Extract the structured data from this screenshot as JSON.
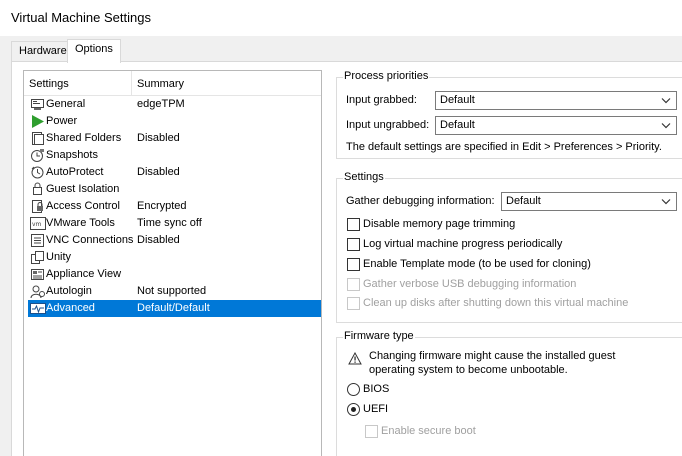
{
  "window": {
    "title": "Virtual Machine Settings"
  },
  "tabs": [
    {
      "label": "Hardware",
      "active": false
    },
    {
      "label": "Options",
      "active": true
    }
  ],
  "settings_list": {
    "columns": [
      "Settings",
      "Summary"
    ],
    "rows": [
      {
        "name": "General",
        "summary": "edgeTPM",
        "icon": "general-icon"
      },
      {
        "name": "Power",
        "summary": "",
        "icon": "power-icon"
      },
      {
        "name": "Shared Folders",
        "summary": "Disabled",
        "icon": "shared-folders-icon"
      },
      {
        "name": "Snapshots",
        "summary": "",
        "icon": "snapshots-icon"
      },
      {
        "name": "AutoProtect",
        "summary": "Disabled",
        "icon": "autoprotect-icon"
      },
      {
        "name": "Guest Isolation",
        "summary": "",
        "icon": "guest-isolation-icon"
      },
      {
        "name": "Access Control",
        "summary": "Encrypted",
        "icon": "access-control-icon"
      },
      {
        "name": "VMware Tools",
        "summary": "Time sync off",
        "icon": "vmware-tools-icon"
      },
      {
        "name": "VNC Connections",
        "summary": "Disabled",
        "icon": "vnc-connections-icon"
      },
      {
        "name": "Unity",
        "summary": "",
        "icon": "unity-icon"
      },
      {
        "name": "Appliance View",
        "summary": "",
        "icon": "appliance-view-icon"
      },
      {
        "name": "Autologin",
        "summary": "Not supported",
        "icon": "autologin-icon"
      },
      {
        "name": "Advanced",
        "summary": "Default/Default",
        "icon": "advanced-icon",
        "selected": true
      }
    ]
  },
  "process_priorities": {
    "label": "Process priorities",
    "grabbed_label": "Input grabbed:",
    "grabbed_value": "Default",
    "ungrabbed_label": "Input ungrabbed:",
    "ungrabbed_value": "Default",
    "note": "The default settings are specified in Edit > Preferences > Priority."
  },
  "settings_group": {
    "label": "Settings",
    "debug_label": "Gather debugging information:",
    "debug_value": "Default",
    "checkboxes": [
      {
        "label": "Disable memory page trimming",
        "checked": false,
        "enabled": true
      },
      {
        "label": "Log virtual machine progress periodically",
        "checked": false,
        "enabled": true
      },
      {
        "label": "Enable Template mode (to be used for cloning)",
        "checked": false,
        "enabled": true
      },
      {
        "label": "Gather verbose USB debugging information",
        "checked": false,
        "enabled": false
      },
      {
        "label": "Clean up disks after shutting down this virtual machine",
        "checked": false,
        "enabled": false
      }
    ]
  },
  "firmware": {
    "label": "Firmware type",
    "warning_line1": "Changing firmware might cause the installed guest",
    "warning_line2": "operating system to become unbootable.",
    "bios_label": "BIOS",
    "uefi_label": "UEFI",
    "selected": "UEFI",
    "secure_boot_label": "Enable secure boot"
  },
  "colors": {
    "selection": "#0078d7",
    "power_green": "#2e9e2e",
    "warning_yellow": "#f2c200"
  }
}
